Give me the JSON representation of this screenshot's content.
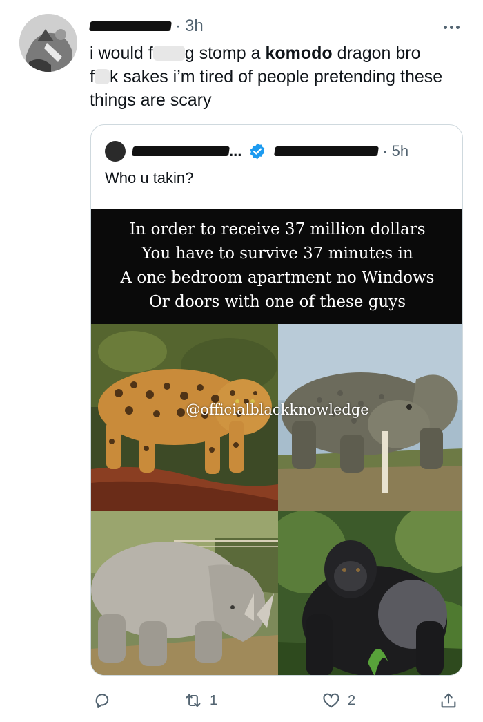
{
  "tweet": {
    "time": "3h",
    "text": {
      "p1": "i would f",
      "p2": "g stomp a ",
      "p3": "komodo",
      "p4": " dragon bro",
      "p5": "f",
      "p6": "k sakes i’m tired of people pretending these",
      "p7": "things are scary"
    }
  },
  "quote": {
    "name_suffix": "...",
    "time": "5h",
    "text": "Who u takin?",
    "caption": [
      "In order to receive 37 million dollars",
      "You have to survive 37 minutes in",
      "A one bedroom apartment no Windows",
      "Or doors with one of these guys"
    ],
    "watermark": "@officialblackknowledge"
  },
  "actions": {
    "retweet_count": "1",
    "like_count": "2"
  },
  "colors": {
    "text": "#0f1419",
    "secondary": "#536471",
    "border": "#cfd9de",
    "verified": "#1d9bf0"
  },
  "icons": [
    "more-icon",
    "verified-icon",
    "reply-icon",
    "retweet-icon",
    "like-icon",
    "share-icon"
  ]
}
